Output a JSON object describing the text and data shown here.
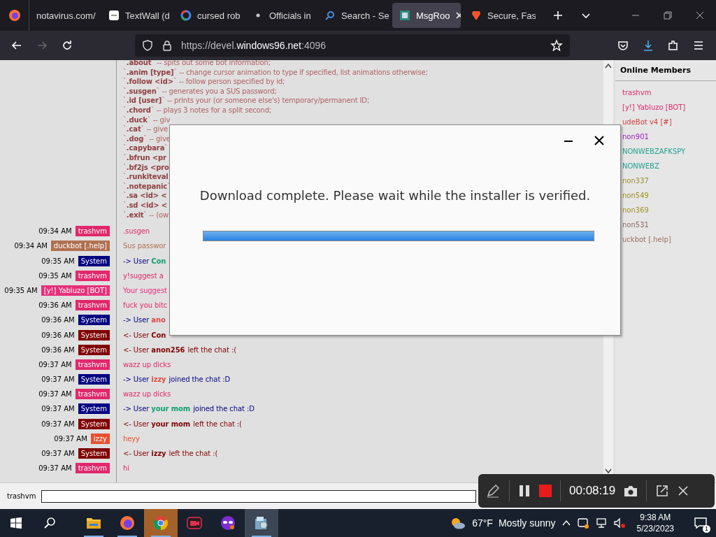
{
  "browser": {
    "tabs": [
      {
        "label": "notavirus.com/",
        "kind": "plain",
        "selected": false
      },
      {
        "label": "TextWall (d",
        "kind": "textwall",
        "selected": false
      },
      {
        "label": "cursed rob",
        "kind": "google",
        "selected": false
      },
      {
        "label": "Officials in",
        "kind": "dot",
        "selected": false
      },
      {
        "label": "Search - Se",
        "kind": "search",
        "selected": false
      },
      {
        "label": "MsgRoo",
        "kind": "msgroom",
        "selected": true
      },
      {
        "label": "Secure, Fas",
        "kind": "brave",
        "selected": false
      }
    ],
    "url": {
      "prefix": "https://devel.",
      "domain": "windows96.net",
      "suffix": ":4096"
    }
  },
  "chat": {
    "commands": [
      "`**.about**` -- spits out some bot information;",
      "`**.anim [type]**` -- change cursor animation to type if specified, list animations otherwise;",
      "`**.follow <id>**` -- follow person specified by id;",
      "`**.susgen**` -- generates you a SUS password;",
      "`**.id [user]**` -- prints your (or someone else's) temporary/permanent ID;",
      "`**.chord**` -- plays 3 notes for a split second;",
      "`**.duck**` -- giv",
      "`**.cat**` -- give",
      "`**.dog**` -- give",
      "`**.capybara**`",
      "`**.bfrun <pr**",
      "`**.bf2js <pro**",
      "`**.runkiteval**",
      "`**.notepanic**`",
      "`**.sa <id> <**",
      "`**.sd <id> <**",
      "`**.exit**` -- (ow"
    ],
    "messages": [
      {
        "kind": "chat",
        "time": "09:34 AM",
        "name": "trashvm",
        "color": "#e0286a",
        "text": ".susgen"
      },
      {
        "kind": "chat",
        "time": "09:34 AM",
        "name": "duckbot [.help]",
        "color": "#b07050",
        "text": "Sus passwor"
      },
      {
        "kind": "system",
        "time": "09:35 AM",
        "name": "System",
        "color": "#000080",
        "prefix": "-> User",
        "user": {
          "name": "Con",
          "color": "#10a070"
        }
      },
      {
        "kind": "chat",
        "time": "09:35 AM",
        "name": "trashvm",
        "color": "#e0286a",
        "text": "y!suggest a"
      },
      {
        "kind": "chat",
        "time": "09:35 AM",
        "name": "[y!] Yabluzo [BOT]",
        "color": "#e8307a",
        "text": "Your suggest"
      },
      {
        "kind": "chat",
        "time": "09:36 AM",
        "name": "trashvm",
        "color": "#e0286a",
        "text": "fuck you bitc"
      },
      {
        "kind": "system",
        "time": "09:36 AM",
        "name": "System",
        "color": "#000080",
        "prefix": "-> User",
        "user": {
          "name": "ano",
          "color": "#e04848"
        }
      },
      {
        "kind": "system",
        "time": "09:36 AM",
        "name": "System",
        "color": "#800000",
        "prefix": "<- User",
        "user": {
          "name": "Con",
          "color": "#800000"
        }
      },
      {
        "kind": "system",
        "time": "09:36 AM",
        "name": "System",
        "color": "#800000",
        "prefix": "<- User",
        "user": {
          "name": "anon256",
          "color": "#800000"
        },
        "suffix": "left the chat :("
      },
      {
        "kind": "chat",
        "time": "09:37 AM",
        "name": "trashvm",
        "color": "#e0286a",
        "text": "wazz up dicks"
      },
      {
        "kind": "system",
        "time": "09:37 AM",
        "name": "System",
        "color": "#000080",
        "prefix": "-> User",
        "user": {
          "name": "izzy",
          "color": "#e05040"
        },
        "suffix": "joined the chat :D"
      },
      {
        "kind": "chat",
        "time": "09:37 AM",
        "name": "trashvm",
        "color": "#e0286a",
        "text": "wazz up dicks"
      },
      {
        "kind": "system",
        "time": "09:37 AM",
        "name": "System",
        "color": "#000080",
        "prefix": "-> User",
        "user": {
          "name": "your mom",
          "color": "#10a070"
        },
        "suffix": "joined the chat :D"
      },
      {
        "kind": "system",
        "time": "09:37 AM",
        "name": "System",
        "color": "#800000",
        "prefix": "<- User",
        "user": {
          "name": "your mom",
          "color": "#800000"
        },
        "suffix": "left the chat :("
      },
      {
        "kind": "chat",
        "time": "09:37 AM",
        "name": "izzy",
        "color": "#e85030",
        "text": "heyy"
      },
      {
        "kind": "system",
        "time": "09:37 AM",
        "name": "System",
        "color": "#800000",
        "prefix": "<- User",
        "user": {
          "name": "izzy",
          "color": "#800000"
        },
        "suffix": "left the chat :("
      },
      {
        "kind": "chat",
        "time": "09:37 AM",
        "name": "trashvm",
        "color": "#e0286a",
        "text": "hi"
      }
    ],
    "members_title": "Online Members",
    "members": [
      {
        "name": "trashvm",
        "color": "#e0286a"
      },
      {
        "name": "[y!] Yabluzo [BOT]",
        "color": "#e0286a"
      },
      {
        "name": "udeBot v4 [#]",
        "color": "#d04040"
      },
      {
        "name": "non901",
        "color": "#a020c0"
      },
      {
        "name": "NONWEBZAFKSPY",
        "color": "#20a090"
      },
      {
        "name": "NONWEBZ",
        "color": "#20a090"
      },
      {
        "name": "non337",
        "color": "#a09030"
      },
      {
        "name": "non549",
        "color": "#a09020"
      },
      {
        "name": "non369",
        "color": "#a09020"
      },
      {
        "name": "non531",
        "color": "#906868"
      },
      {
        "name": "uckbot [.help]",
        "color": "#a07060"
      }
    ],
    "input_label": "trashvm"
  },
  "dialog": {
    "message": "Download complete. Please wait while the installer is verified.",
    "level": 1
  },
  "recorder": {
    "elapsed": "00:08:19"
  },
  "taskbar": {
    "apps": [
      {
        "kind": "folder",
        "running": true,
        "flashing": false,
        "selected": false
      },
      {
        "kind": "firefox",
        "running": true,
        "flashing": false,
        "selected": false
      },
      {
        "kind": "chrome",
        "running": true,
        "flashing": true,
        "selected": false
      },
      {
        "kind": "recorder",
        "running": false,
        "flashing": false,
        "selected": false
      },
      {
        "kind": "mask",
        "running": false,
        "flashing": false,
        "selected": false
      },
      {
        "kind": "installer",
        "running": true,
        "flashing": false,
        "selected": true
      }
    ],
    "temperature": "67°F",
    "weather": "Mostly sunny",
    "time": "9:38 AM",
    "date": "5/23/2023",
    "notifications": "1"
  }
}
